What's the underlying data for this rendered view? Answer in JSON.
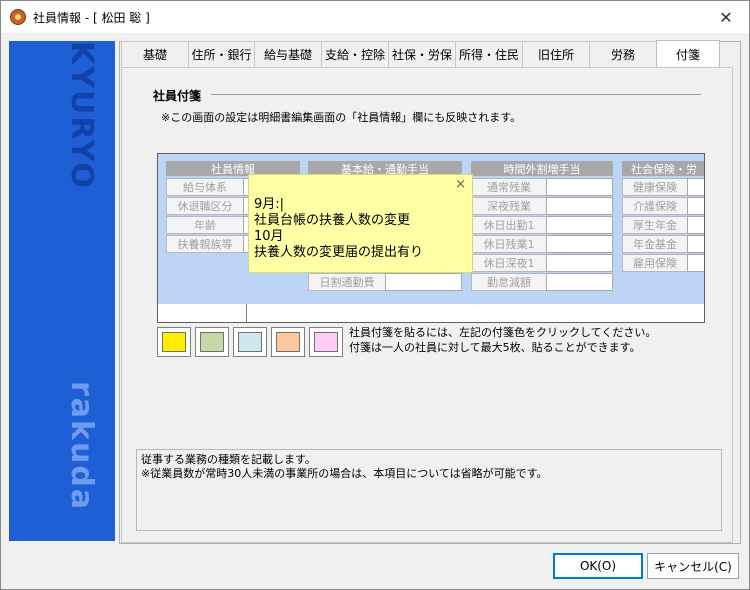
{
  "window": {
    "title": "社員情報 - [ 松田 聡 ]"
  },
  "sidebar": {
    "logo_top": "KYURYO",
    "logo_bottom": "rakuda"
  },
  "tabs": [
    {
      "label": "基礎",
      "width": 68
    },
    {
      "label": "住所・銀行",
      "width": 67
    },
    {
      "label": "給与基礎",
      "width": 68
    },
    {
      "label": "支給・控除",
      "width": 68
    },
    {
      "label": "社保・労保",
      "width": 68
    },
    {
      "label": "所得・住民",
      "width": 68
    },
    {
      "label": "旧住所",
      "width": 68
    },
    {
      "label": "労務",
      "width": 68
    },
    {
      "label": "付箋",
      "width": 64
    }
  ],
  "active_tab": "付箋",
  "section": {
    "title": "社員付箋",
    "note": "※この画面の設定は明細書編集画面の「社員情報」欄にも反映されます。"
  },
  "preview": {
    "groups": [
      {
        "head": "社員情報",
        "labels": [
          "給与体系",
          "休退職区分",
          "年齢",
          "扶養親族等"
        ]
      },
      {
        "head": "基本給・通勤手当",
        "labels": [
          "日割通勤費"
        ]
      },
      {
        "head": "時間外割増手当",
        "labels": [
          "通常残業",
          "深夜残業",
          "休日出勤1",
          "休日残業1",
          "休日深夜1",
          "勤怠減額"
        ]
      },
      {
        "head": "社会保険・労",
        "labels": [
          "健康保険",
          "介護保険",
          "厚生年金",
          "年金基金",
          "雇用保険"
        ]
      }
    ]
  },
  "sticky_note": {
    "close_icon": "×",
    "text": "9月:|\n社員台帳の扶養人数の変更\n10月\n扶養人数の変更届の提出有り"
  },
  "colors": {
    "swatches": [
      "#ffee00",
      "#c5d9a8",
      "#cfe8f0",
      "#f9c8a0",
      "#ffccf7"
    ],
    "accent": "#1e5fd6"
  },
  "instructions": {
    "line1": "社員付箋を貼るには、左記の付箋色をクリックしてください。",
    "line2": "付箋は一人の社員に対して最大5枚、貼ることができます。"
  },
  "description": {
    "line1": "従事する業務の種類を記載します。",
    "line2": "※従業員数が常時30人未満の事業所の場合は、本項目については省略が可能です。"
  },
  "buttons": {
    "ok": "OK(O)",
    "cancel": "キャンセル(C)"
  }
}
